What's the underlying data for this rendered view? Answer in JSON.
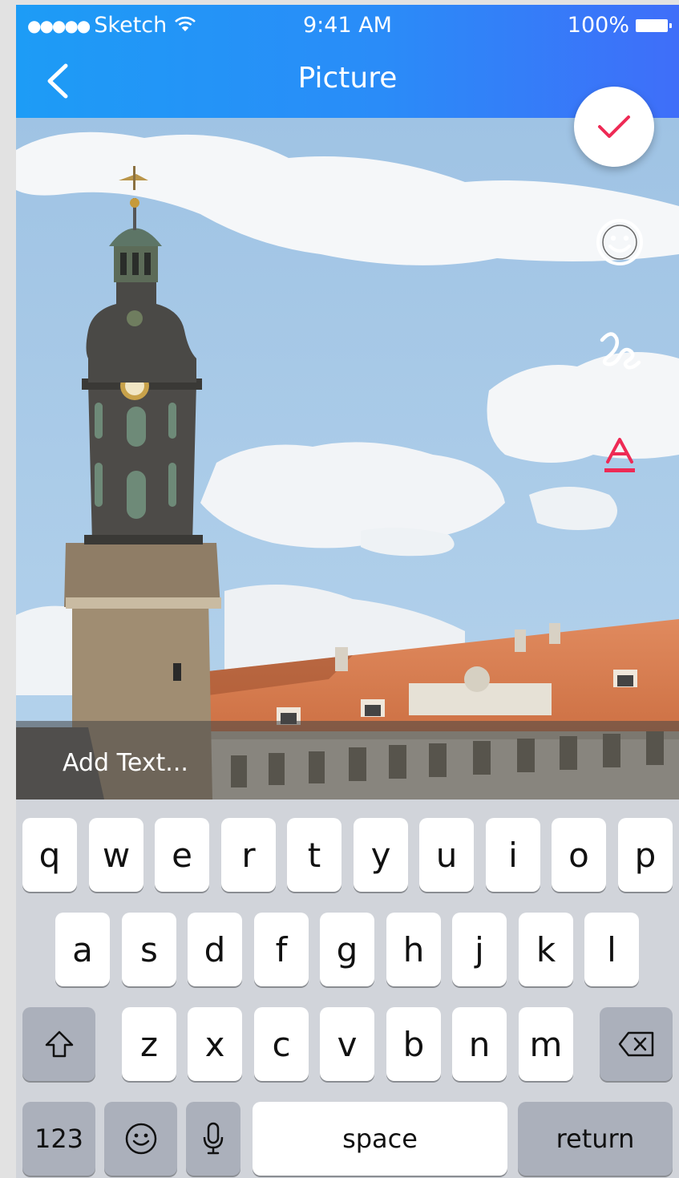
{
  "status_bar": {
    "signal_dots": "●●●●●",
    "carrier": "Sketch",
    "wifi_icon": "wifi-icon",
    "time": "9:41 AM",
    "battery": "100%"
  },
  "header": {
    "title": "Picture",
    "back_icon": "chevron-left-icon",
    "accent": "#1d9cf6"
  },
  "tools": {
    "confirm_icon": "checkmark-icon",
    "sticker_icon": "smiley-icon",
    "draw_icon": "squiggle-icon",
    "text_icon": "text-a-icon",
    "confirm_color": "#ee2a55"
  },
  "caption": {
    "placeholder": "Add Text..."
  },
  "keyboard": {
    "row1": [
      "q",
      "w",
      "e",
      "r",
      "t",
      "y",
      "u",
      "i",
      "o",
      "p"
    ],
    "row2": [
      "a",
      "s",
      "d",
      "f",
      "g",
      "h",
      "j",
      "k",
      "l"
    ],
    "row3": [
      "z",
      "x",
      "c",
      "v",
      "b",
      "n",
      "m"
    ],
    "shift_icon": "shift-icon",
    "delete_icon": "backspace-icon",
    "numbers": "123",
    "emoji_icon": "emoji-icon",
    "mic_icon": "microphone-icon",
    "space": "space",
    "return": "return"
  }
}
